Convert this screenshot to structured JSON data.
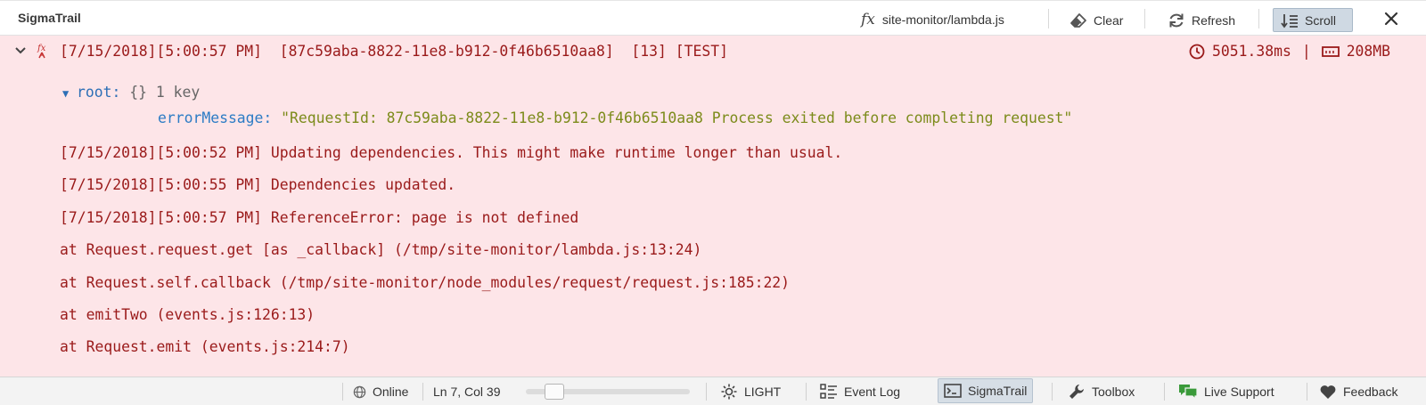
{
  "app": {
    "title": "SigmaTrail"
  },
  "toolbar": {
    "fx_symbol": "fx",
    "file": "site-monitor/lambda.js",
    "clear_label": "Clear",
    "refresh_label": "Refresh",
    "scroll_label": "Scroll",
    "scroll_active": true
  },
  "entry": {
    "header": "[7/15/2018][5:00:57 PM]  [87c59aba-8822-11e8-b912-0f46b6510aa8]  [13] [TEST]",
    "duration": "5051.38ms",
    "separator": "|",
    "memory": "208MB",
    "object": {
      "root_label": "root:",
      "root_braces": "{}",
      "root_count": "1 key",
      "prop_key": "errorMessage:",
      "prop_value": "\"RequestId: 87c59aba-8822-11e8-b912-0f46b6510aa8 Process exited before completing request\""
    },
    "lines": [
      "[7/15/2018][5:00:52 PM] Updating dependencies. This might make runtime longer than usual.",
      "[7/15/2018][5:00:55 PM] Dependencies updated.",
      "[7/15/2018][5:00:57 PM] ReferenceError: page is not defined",
      "at Request.request.get [as _callback] (/tmp/site-monitor/lambda.js:13:24)",
      "at Request.self.callback (/tmp/site-monitor/node_modules/request/request.js:185:22)",
      "at emitTwo (events.js:126:13)",
      "at Request.emit (events.js:214:7)"
    ]
  },
  "statusbar": {
    "online_label": "Online",
    "cursor_pos": "Ln 7, Col 39",
    "zoom_level": 0.13,
    "theme_label": "LIGHT",
    "eventlog_label": "Event Log",
    "sigmatrail_label": "SigmaTrail",
    "toolbox_label": "Toolbox",
    "support_label": "Live Support",
    "feedback_label": "Feedback"
  },
  "colors": {
    "error_bg": "#fde5e8",
    "error_text": "#9a1a1a",
    "key_blue": "#2d7cc5",
    "string_olive": "#7c8b1a",
    "accent_green": "#3a9a3a"
  }
}
